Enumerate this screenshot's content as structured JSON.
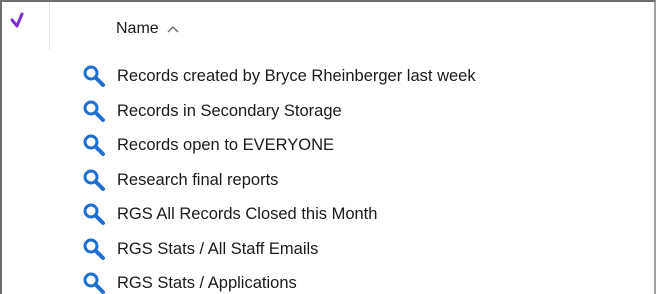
{
  "colors": {
    "check_accent": "#7b2fd1",
    "search_icon": "#1e6fd0"
  },
  "header": {
    "check_icon": "checkmark-icon",
    "name_label": "Name",
    "sort_icon": "chevron-up-icon"
  },
  "rows": [
    {
      "icon": "search-icon",
      "label": "Records created by Bryce Rheinberger last week"
    },
    {
      "icon": "search-icon",
      "label": "Records in Secondary Storage"
    },
    {
      "icon": "search-icon",
      "label": "Records open to EVERYONE"
    },
    {
      "icon": "search-icon",
      "label": "Research final reports"
    },
    {
      "icon": "search-icon",
      "label": "RGS All Records Closed this Month"
    },
    {
      "icon": "search-icon",
      "label": "RGS Stats / All Staff Emails"
    },
    {
      "icon": "search-icon",
      "label": "RGS Stats / Applications"
    }
  ]
}
